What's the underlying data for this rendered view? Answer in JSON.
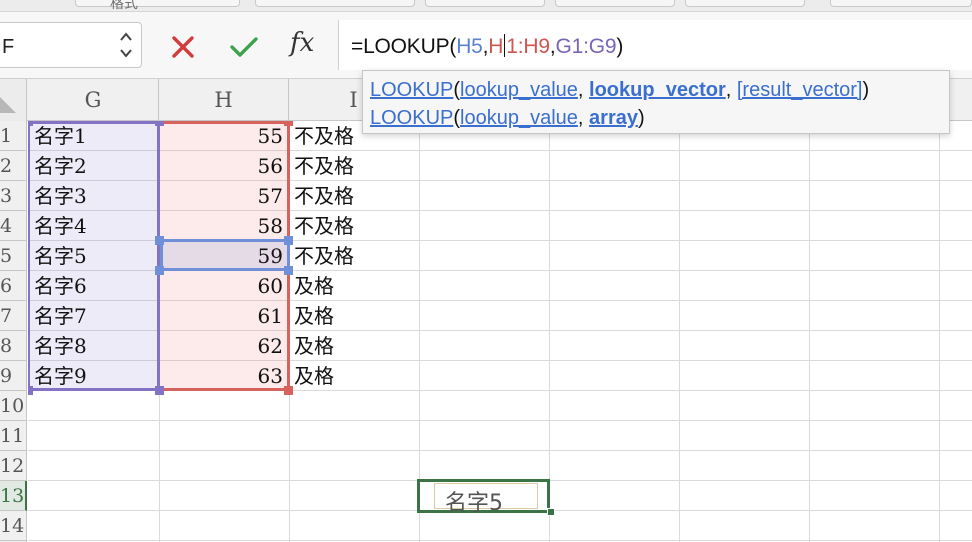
{
  "ribbon": {
    "partial_label": "格式"
  },
  "name_box": {
    "value": "F"
  },
  "formula_bar": {
    "fx_label": "fx",
    "formula": {
      "prefix": "=LOOKUP(",
      "arg1": "H5",
      "sep1": ",",
      "arg2_before_caret": "H",
      "arg2_after_caret": "1:H9",
      "sep2": ",",
      "arg3": "G1:G9",
      "suffix": ")"
    }
  },
  "tooltip": {
    "row1": {
      "fn": "LOOKUP",
      "open": "(",
      "p1": "lookup_value",
      "comma1": ", ",
      "p2": "lookup_vector",
      "comma2": ", ",
      "p3": "[result_vector]",
      "close": ")"
    },
    "row2": {
      "fn": "LOOKUP",
      "open": "(",
      "p1": "lookup_value",
      "comma1": ", ",
      "p2": "array",
      "close": ")"
    }
  },
  "columns": [
    "G",
    "H",
    "I",
    "",
    "",
    "",
    "",
    ""
  ],
  "rows": [
    "1",
    "2",
    "3",
    "4",
    "5",
    "6",
    "7",
    "8",
    "9",
    "10",
    "11",
    "12",
    "13",
    "14"
  ],
  "table": [
    {
      "name": "名字1",
      "score": "55",
      "grade": "不及格"
    },
    {
      "name": "名字2",
      "score": "56",
      "grade": "不及格"
    },
    {
      "name": "名字3",
      "score": "57",
      "grade": "不及格"
    },
    {
      "name": "名字4",
      "score": "58",
      "grade": "不及格"
    },
    {
      "name": "名字5",
      "score": "59",
      "grade": "不及格"
    },
    {
      "name": "名字6",
      "score": "60",
      "grade": "及格"
    },
    {
      "name": "名字7",
      "score": "61",
      "grade": "及格"
    },
    {
      "name": "名字8",
      "score": "62",
      "grade": "及格"
    },
    {
      "name": "名字9",
      "score": "63",
      "grade": "及格"
    }
  ],
  "active_cell": {
    "row": "13",
    "value": "名字5"
  },
  "colors": {
    "range_g": "#8473c4",
    "range_h": "#d8625d",
    "range_h5": "#6f8fd9",
    "active": "#3a7446",
    "cancel": "#d23c3c",
    "confirm": "#3fa34d"
  },
  "icons": {
    "cancel": "close-icon",
    "confirm": "checkmark-icon",
    "fx": "fx-icon",
    "stepper": "chevron-updown-icon"
  }
}
